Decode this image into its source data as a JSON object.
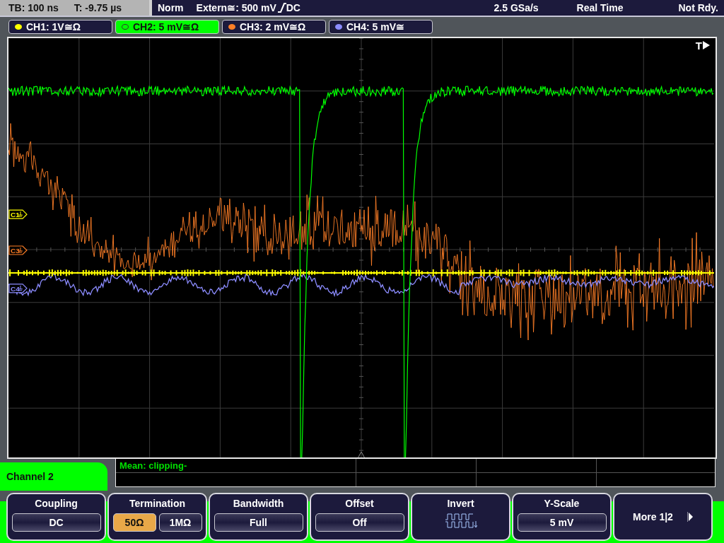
{
  "status_bar": {
    "timebase": "TB: 100 ns",
    "trigger_time": "T: -9.75 µs",
    "mode": "Norm",
    "trigger_source": "Extern≅: 500 mV",
    "trigger_coupling": "DC",
    "sample_rate": "2.5 GSa/s",
    "acquisition": "Real Time",
    "status": "Not Rdy."
  },
  "channels": [
    {
      "label": "CH1: 1V≅Ω",
      "color": "#ffff00",
      "selected": false
    },
    {
      "label": "CH2: 5 mV≅Ω",
      "color": "#00ff00",
      "selected": true
    },
    {
      "label": "CH3: 2 mV≅Ω",
      "color": "#ff7f27",
      "selected": false
    },
    {
      "label": "CH4: 5 mV≅",
      "color": "#8c8cff",
      "selected": false
    }
  ],
  "trigger_marker": "T",
  "markers": [
    {
      "label": "C1",
      "color": "#ffff00"
    },
    {
      "label": "C3",
      "color": "#ff7f27"
    },
    {
      "label": "C4",
      "color": "#8c8cff"
    }
  ],
  "measurement": "Mean: clipping-",
  "menu": {
    "title": "Channel 2",
    "softkeys": [
      {
        "kind": "value",
        "label": "Coupling",
        "value": "DC"
      },
      {
        "kind": "toggle",
        "label": "Termination",
        "options": [
          {
            "label": "50Ω",
            "selected": true
          },
          {
            "label": "1MΩ",
            "selected": false
          }
        ]
      },
      {
        "kind": "value",
        "label": "Bandwidth",
        "value": "Full"
      },
      {
        "kind": "value",
        "label": "Offset",
        "value": "Off"
      },
      {
        "kind": "icon",
        "label": "Invert"
      },
      {
        "kind": "value",
        "label": "Y-Scale",
        "value": "5 mV"
      },
      {
        "kind": "more",
        "label": "More 1|2"
      }
    ]
  }
}
